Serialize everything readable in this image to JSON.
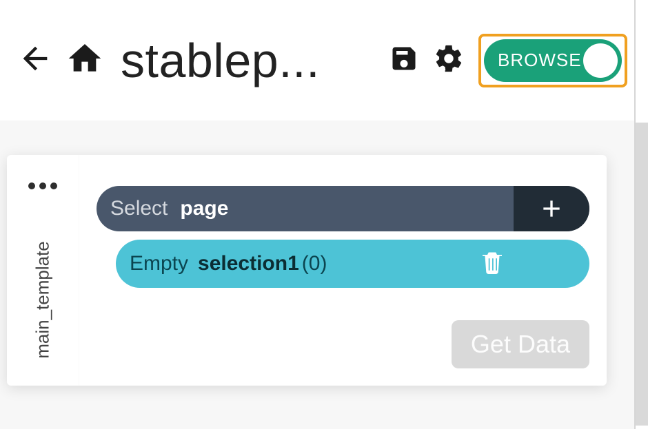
{
  "header": {
    "title": "stablep...",
    "toggle_label": "BROWSE"
  },
  "sidebar": {
    "tab_label": "main_template"
  },
  "select_bar": {
    "label": "Select",
    "value": "page"
  },
  "selection": {
    "status": "Empty",
    "name": "selection1",
    "count": "(0)"
  },
  "buttons": {
    "get_data": "Get Data"
  }
}
